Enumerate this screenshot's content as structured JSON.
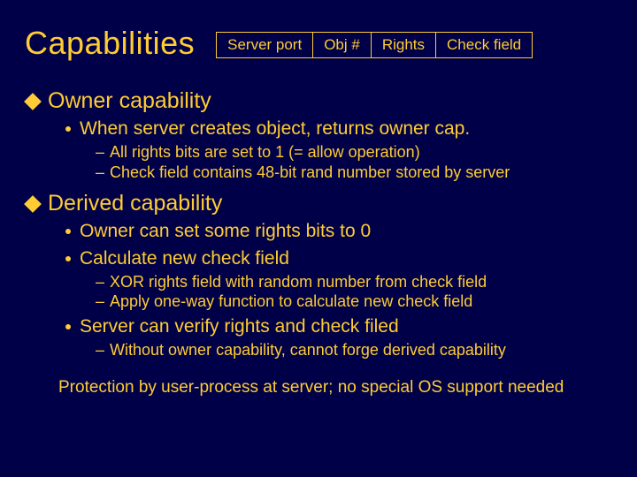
{
  "title": "Capabilities",
  "fields": {
    "c0": "Server port",
    "c1": "Obj #",
    "c2": "Rights",
    "c3": "Check field"
  },
  "sec1": {
    "title": "Owner capability",
    "b1": "When server creates object, returns owner cap.",
    "s1": "All rights bits are set to 1  (= allow operation)",
    "s2": "Check field contains 48-bit rand number stored by server"
  },
  "sec2": {
    "title": "Derived capability",
    "b1": "Owner can set some rights bits to 0",
    "b2": "Calculate new check field",
    "s1": "XOR rights field with random number from check field",
    "s2": "Apply one-way function to calculate new check field",
    "b3": "Server can verify rights and check filed",
    "s3": "Without owner capability, cannot forge derived capability"
  },
  "footer": "Protection by user-process at server; no special OS support needed"
}
